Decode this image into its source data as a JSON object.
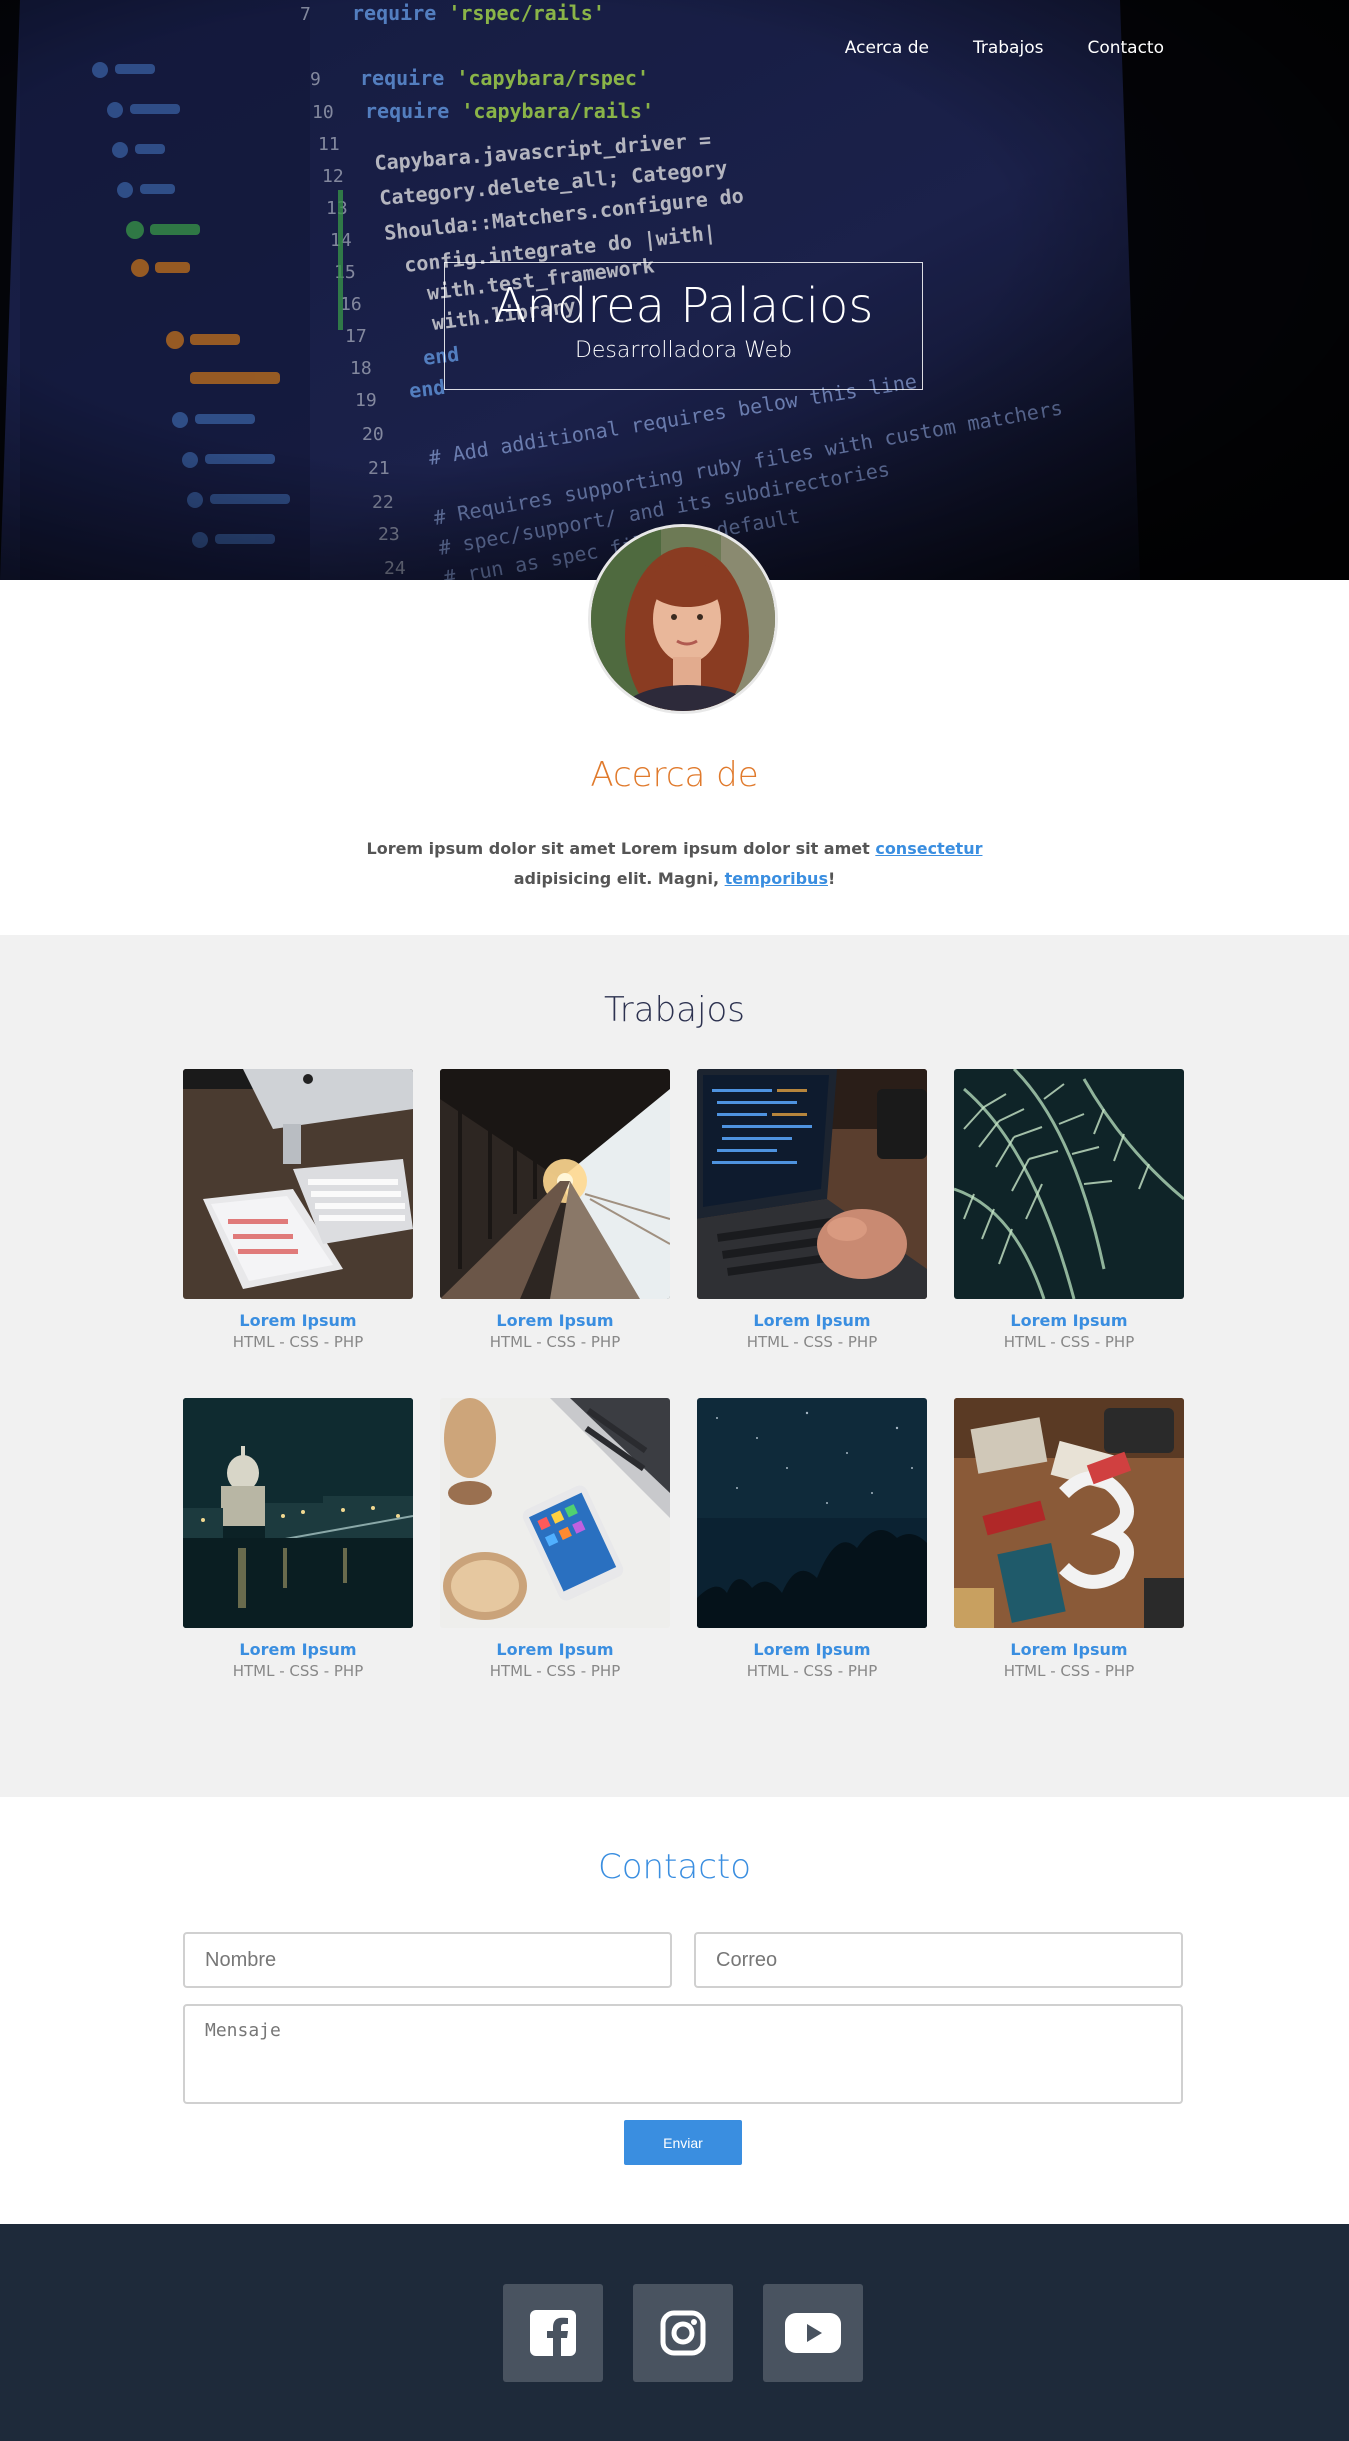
{
  "nav": {
    "items": [
      "Acerca de",
      "Trabajos",
      "Contacto"
    ]
  },
  "hero": {
    "name": "Andrea Palacios",
    "role": "Desarrolladora Web"
  },
  "about": {
    "title": "Acerca de",
    "text_a": "Lorem ipsum dolor sit amet Lorem ipsum dolor sit amet ",
    "link_a": "consectetur",
    "text_b": " adipisicing elit. Magni, ",
    "link_b": "temporibus",
    "text_c": "!"
  },
  "works": {
    "title": "Trabajos",
    "items": [
      {
        "title": "Lorem Ipsum",
        "sub": "HTML - CSS - PHP",
        "image": "desk-imac-tablet"
      },
      {
        "title": "Lorem Ipsum",
        "sub": "HTML - CSS - PHP",
        "image": "train-station-sunset"
      },
      {
        "title": "Lorem Ipsum",
        "sub": "HTML - CSS - PHP",
        "image": "laptop-coding"
      },
      {
        "title": "Lorem Ipsum",
        "sub": "HTML - CSS - PHP",
        "image": "fern-leaves"
      },
      {
        "title": "Lorem Ipsum",
        "sub": "HTML - CSS - PHP",
        "image": "city-night-cathedral"
      },
      {
        "title": "Lorem Ipsum",
        "sub": "HTML - CSS - PHP",
        "image": "phone-laptop-desk"
      },
      {
        "title": "Lorem Ipsum",
        "sub": "HTML - CSS - PHP",
        "image": "starry-night-trees"
      },
      {
        "title": "Lorem Ipsum",
        "sub": "HTML - CSS - PHP",
        "image": "design-desk-items"
      }
    ]
  },
  "contact": {
    "title": "Contacto",
    "name_placeholder": "Nombre",
    "email_placeholder": "Correo",
    "message_placeholder": "Mensaje",
    "send_label": "Enviar"
  },
  "footer": {
    "social": [
      "facebook-icon",
      "instagram-icon",
      "youtube-icon"
    ]
  },
  "colors": {
    "accent_orange": "#e07a2c",
    "accent_blue": "#3a8ee0",
    "footer_bg": "#1e2a3a",
    "works_bg": "#f1f1f1"
  }
}
